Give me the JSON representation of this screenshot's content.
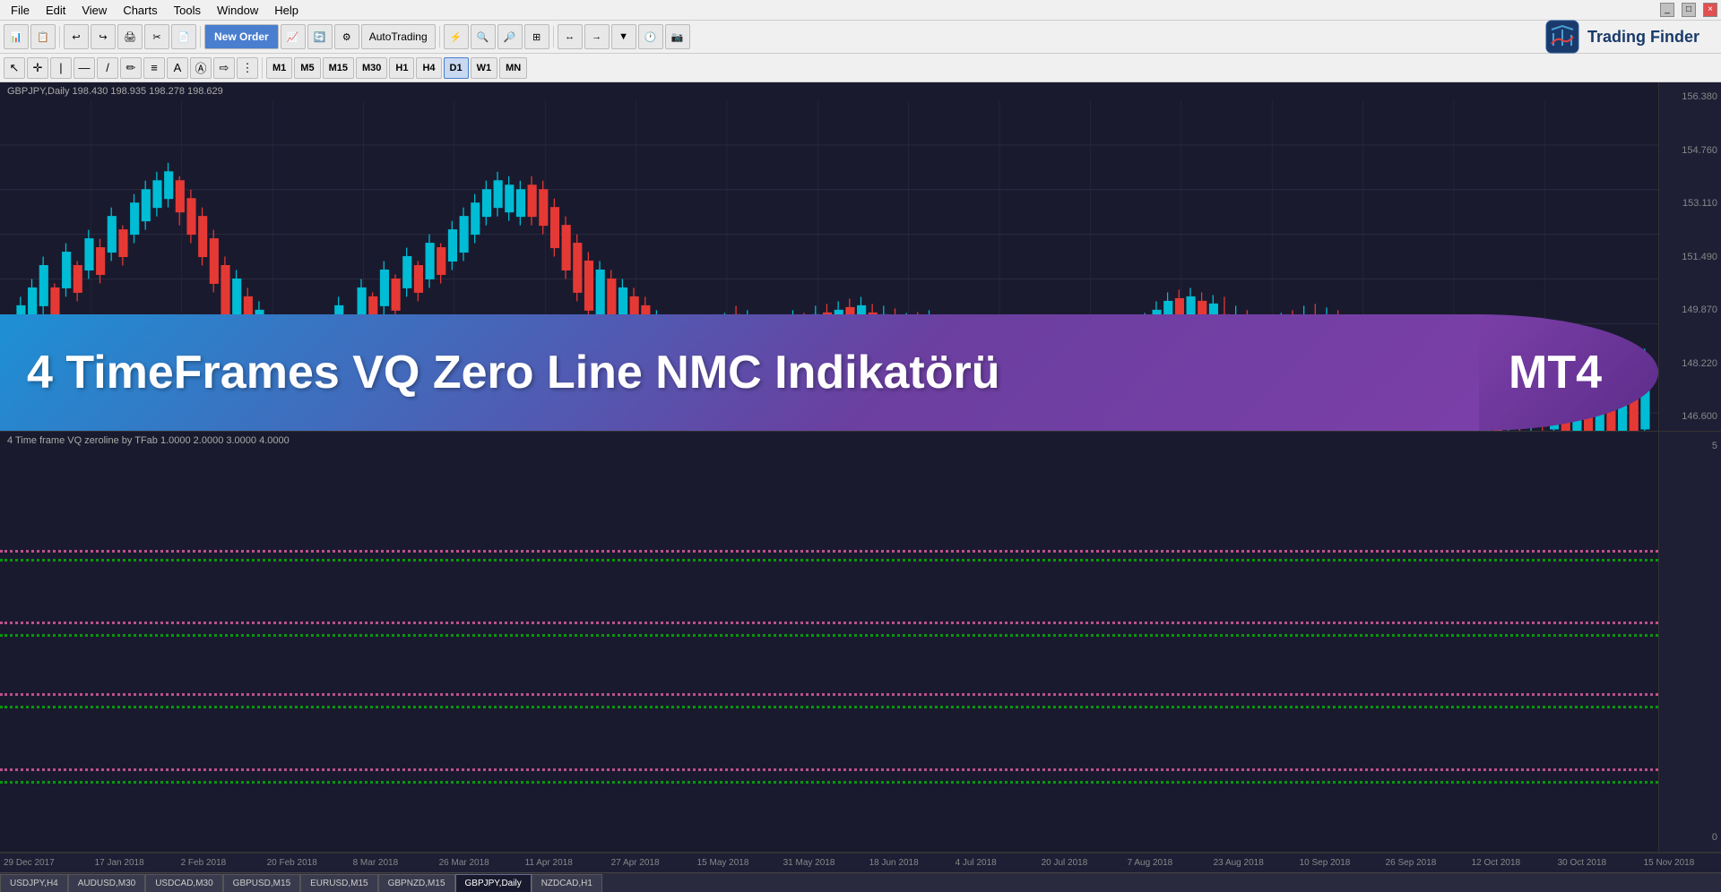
{
  "menu": {
    "items": [
      "File",
      "Edit",
      "View",
      "Charts",
      "Tools",
      "Window",
      "Help"
    ]
  },
  "toolbar": {
    "new_order_label": "New Order",
    "auto_trading_label": "AutoTrading"
  },
  "timeframes": {
    "buttons": [
      "M1",
      "M5",
      "M15",
      "M30",
      "H1",
      "H4",
      "D1",
      "W1",
      "MN"
    ]
  },
  "chart": {
    "symbol": "GBPJPY",
    "timeframe": "Daily",
    "ohlc": "198.430 198.935 198.278 198.629",
    "info_label": "GBPJPY,Daily  198.430 198.935 198.278 198.629"
  },
  "price_levels": [
    "156.380",
    "154.760",
    "153.110",
    "151.490",
    "149.870",
    "148.220",
    "146.600"
  ],
  "indicator": {
    "info_label": "4 Time frame VQ zeroline by TFab 1.0000 2.0000 3.0000 4.0000",
    "scale_top": "5",
    "scale_bottom": "0",
    "lines": [
      {
        "color": "#ff69b4",
        "secondary_color": "#00cc00",
        "top": "30%"
      },
      {
        "color": "#ff69b4",
        "secondary_color": "#00cc00",
        "top": "47%"
      },
      {
        "color": "#ff69b4",
        "secondary_color": "#00cc00",
        "top": "64%"
      },
      {
        "color": "#ff69b4",
        "secondary_color": "#00cc00",
        "top": "81%"
      }
    ]
  },
  "time_labels": [
    {
      "text": "29 Dec 2017",
      "left": "0%"
    },
    {
      "text": "17 Jan 2018",
      "left": "5.5%"
    },
    {
      "text": "2 Feb 2018",
      "left": "10.5%"
    },
    {
      "text": "20 Feb 2018",
      "left": "15.5%"
    },
    {
      "text": "8 Mar 2018",
      "left": "20.5%"
    },
    {
      "text": "26 Mar 2018",
      "left": "25.5%"
    },
    {
      "text": "11 Apr 2018",
      "left": "30.5%"
    },
    {
      "text": "27 Apr 2018",
      "left": "35.5%"
    },
    {
      "text": "15 May 2018",
      "left": "40.5%"
    },
    {
      "text": "31 May 2018",
      "left": "45.5%"
    },
    {
      "text": "18 Jun 2018",
      "left": "50.5%"
    },
    {
      "text": "4 Jul 2018",
      "left": "55.5%"
    },
    {
      "text": "20 Jul 2018",
      "left": "60.5%"
    },
    {
      "text": "7 Aug 2018",
      "left": "65.5%"
    },
    {
      "text": "23 Aug 2018",
      "left": "70.5%"
    },
    {
      "text": "10 Sep 2018",
      "left": "75.5%"
    },
    {
      "text": "26 Sep 2018",
      "left": "80.5%"
    },
    {
      "text": "12 Oct 2018",
      "left": "85.5%"
    },
    {
      "text": "30 Oct 2018",
      "left": "90.5%"
    },
    {
      "text": "15 Nov 2018",
      "left": "95.5%"
    }
  ],
  "tabs": [
    {
      "label": "USDJPY,H4",
      "active": false
    },
    {
      "label": "AUDUSD,M30",
      "active": false
    },
    {
      "label": "USDCAD,M30",
      "active": false
    },
    {
      "label": "GBPUSD,M15",
      "active": false
    },
    {
      "label": "EURUSD,M15",
      "active": false
    },
    {
      "label": "GBPNZD,M15",
      "active": false
    },
    {
      "label": "GBPJPY,Daily",
      "active": true
    },
    {
      "label": "NZDCAD,H1",
      "active": false
    }
  ],
  "banner": {
    "title": "4 TimeFrames VQ Zero Line NMC Indikatörü",
    "badge": "MT4"
  },
  "logo": {
    "text": "Trading Finder"
  }
}
